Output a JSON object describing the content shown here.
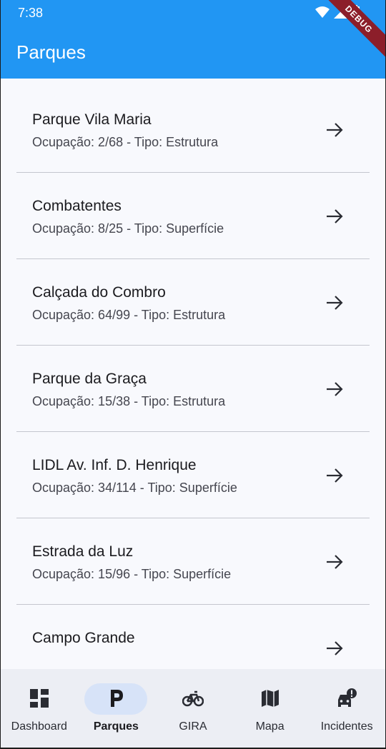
{
  "status_bar": {
    "time": "7:38",
    "debug_label": "DEBUG"
  },
  "app_bar": {
    "title": "Parques"
  },
  "parks": [
    {
      "name": "Parque Vila Maria",
      "info": "Ocupação: 2/68 - Tipo: Estrutura"
    },
    {
      "name": "Combatentes",
      "info": "Ocupação: 8/25 - Tipo: Superfície"
    },
    {
      "name": "Calçada do Combro",
      "info": "Ocupação: 64/99 - Tipo: Estrutura"
    },
    {
      "name": "Parque da Graça",
      "info": "Ocupação: 15/38 - Tipo: Estrutura"
    },
    {
      "name": "LIDL Av. Inf. D. Henrique",
      "info": "Ocupação: 34/114 - Tipo: Superfície"
    },
    {
      "name": "Estrada da Luz",
      "info": "Ocupação: 15/96 - Tipo: Superfície"
    },
    {
      "name": "Campo Grande",
      "info": ""
    }
  ],
  "bottom_nav": {
    "items": [
      {
        "label": "Dashboard",
        "icon": "dashboard-icon"
      },
      {
        "label": "Parques",
        "icon": "parking-icon",
        "active": true
      },
      {
        "label": "GIRA",
        "icon": "bike-icon"
      },
      {
        "label": "Mapa",
        "icon": "map-icon"
      },
      {
        "label": "Incidentes",
        "icon": "car-alert-icon"
      }
    ]
  },
  "colors": {
    "app_bar": "#2196f3",
    "background": "#f8f9fd",
    "nav_background": "#eceef4",
    "nav_active_pill": "#d7e3f8"
  }
}
